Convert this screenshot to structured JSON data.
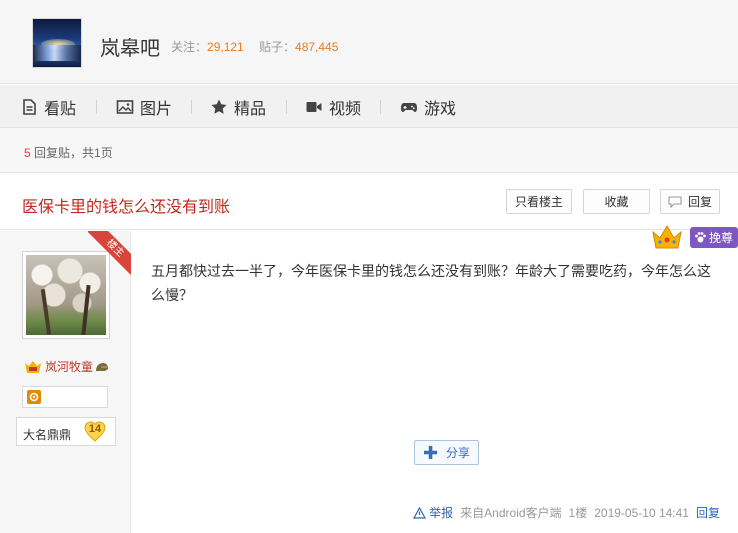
{
  "forum": {
    "name": "岚皋吧",
    "follow_label": "关注：",
    "follow_count": "29,121",
    "posts_label": "贴子：",
    "posts_count": "487,445"
  },
  "nav": {
    "items": [
      {
        "label": "看贴",
        "icon": "document-icon"
      },
      {
        "label": "图片",
        "icon": "image-icon"
      },
      {
        "label": "精品",
        "icon": "star-icon"
      },
      {
        "label": "视频",
        "icon": "video-icon"
      },
      {
        "label": "游戏",
        "icon": "gamepad-icon"
      }
    ]
  },
  "reply_bar": {
    "count": "5",
    "suffix": "回复贴，共1页"
  },
  "thread": {
    "title": "医保卡里的钱怎么还没有到账",
    "only_op_label": "只看楼主",
    "favorite_label": "收藏",
    "reply_label": "回复"
  },
  "post": {
    "op_ribbon": "楼主",
    "author": "岚河牧童",
    "level_name": "大名鼎鼎",
    "level": "14",
    "crown_tag": "挽尊",
    "content": "五月都快过去一半了，今年医保卡里的钱怎么还没有到账？年龄大了需要吃药，今年怎么这么慢？",
    "share_label": "分享",
    "report_label": "举报",
    "source": "来自Android客户端",
    "floor": "1楼",
    "timestamp": "2019-05-10 14:41",
    "reply_link": "回复"
  },
  "colors": {
    "accent_orange": "#e67e22",
    "title_red": "#c3281f",
    "link_blue": "#2d64b3",
    "crown_purple": "#7e57c2"
  }
}
